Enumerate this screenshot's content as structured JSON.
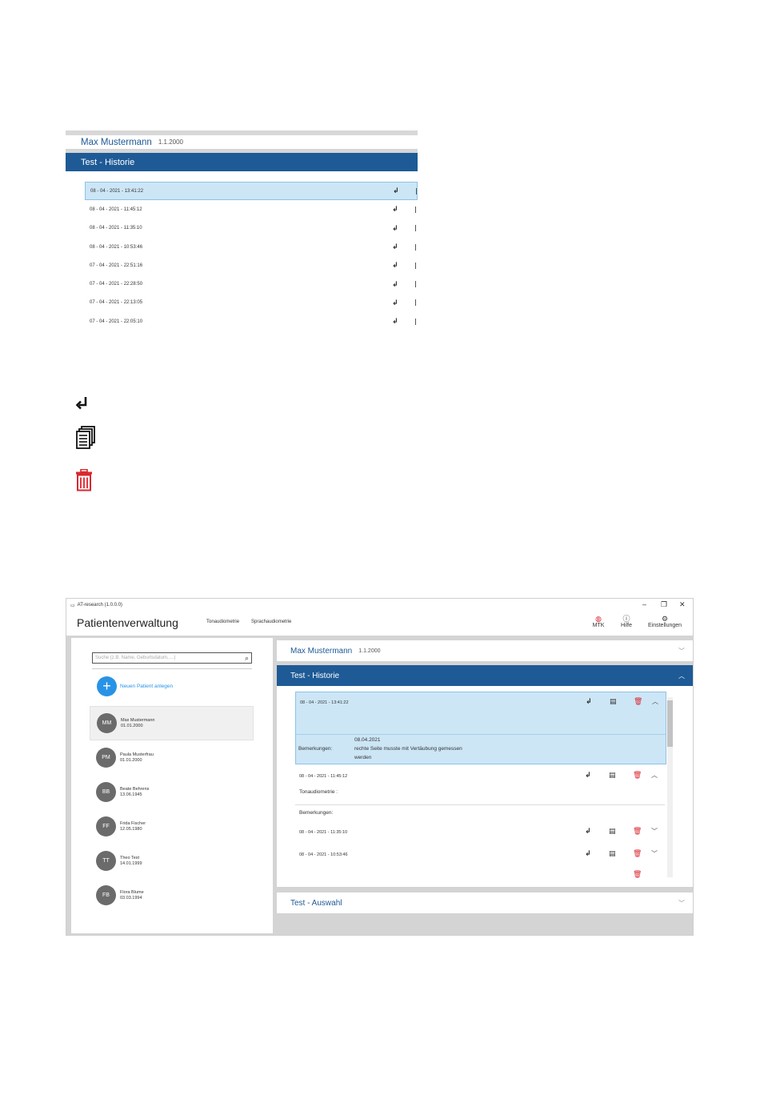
{
  "crop": {
    "patient_name": "Max  Mustermann",
    "patient_dob": "1.1.2000",
    "section_title": "Test - Historie",
    "rows": [
      "08 - 04 - 2021 -  13:41:22",
      "08 - 04 - 2021 -  11:45:12",
      "08 - 04 - 2021 -  11:35:10",
      "08 - 04 - 2021 -  10:53:46",
      "07 - 04 - 2021 -  22:51:16",
      "07 - 04 - 2021 -  22:28:50",
      "07 - 04 - 2021 -  22:13:05",
      "07 - 04 - 2021 -  22:05:10"
    ],
    "return_glyph": "↲"
  },
  "legend": {
    "return_icon": "return-icon",
    "copy_icon": "copy-icon",
    "delete_icon": "trash-icon",
    "delete_color": "#d9272e"
  },
  "window": {
    "title": "AT-research (1.0.0.0)",
    "controls": {
      "minimize": "–",
      "restore": "❐",
      "close": "✕"
    },
    "app_title": "Patientenverwaltung",
    "tabs": [
      "Tonaudiometrie",
      "Sprachaudiometrie"
    ],
    "header_buttons": [
      {
        "label": "MTK",
        "icon": "mtk-icon"
      },
      {
        "label": "Hilfe",
        "icon": "help-icon"
      },
      {
        "label": "Einstellungen",
        "icon": "gear-icon"
      }
    ],
    "search_placeholder": "Suche (z.B. Name, Geburtsdatum,....)",
    "new_patient_label": "Neuen Patient anlegen",
    "patients": [
      {
        "initials": "MM",
        "name": "Max Mustermann",
        "dob": "01.01.2000",
        "selected": true
      },
      {
        "initials": "PM",
        "name": "Paula Musterfrau",
        "dob": "01.01.2000"
      },
      {
        "initials": "BB",
        "name": "Beate Behrens",
        "dob": "13.06.1945"
      },
      {
        "initials": "FF",
        "name": "Frida Fischer",
        "dob": "12.05.1980"
      },
      {
        "initials": "TT",
        "name": "Theo Test",
        "dob": "14.01.1999"
      },
      {
        "initials": "FB",
        "name": "Flora Blume",
        "dob": "03.03.1994"
      }
    ],
    "right": {
      "patient_name": "Max  Mustermann",
      "patient_dob": "1.1.2000",
      "historie_title": "Test - Historie",
      "auswahl_title": "Test - Auswahl",
      "entries": [
        {
          "timestamp": "08 - 04 - 2021 -  13:41:22",
          "date_note": "08.04.2021",
          "remarks_label": "Bemerkungen:",
          "remarks_line1": "rechte Seite musste mit Vertäubung gemessen",
          "remarks_line2": "werden",
          "expanded": true
        },
        {
          "timestamp": "08 - 04 - 2021 -  11:45:12",
          "test_label": "Tonaudiometrie :",
          "remarks_label": "Bemerkungen:",
          "expanded": true
        },
        {
          "timestamp": "08 - 04 - 2021 -  11:35:10",
          "expanded": false
        },
        {
          "timestamp": "08 - 04 - 2021 -  10:53:46",
          "expanded": false
        }
      ]
    }
  }
}
